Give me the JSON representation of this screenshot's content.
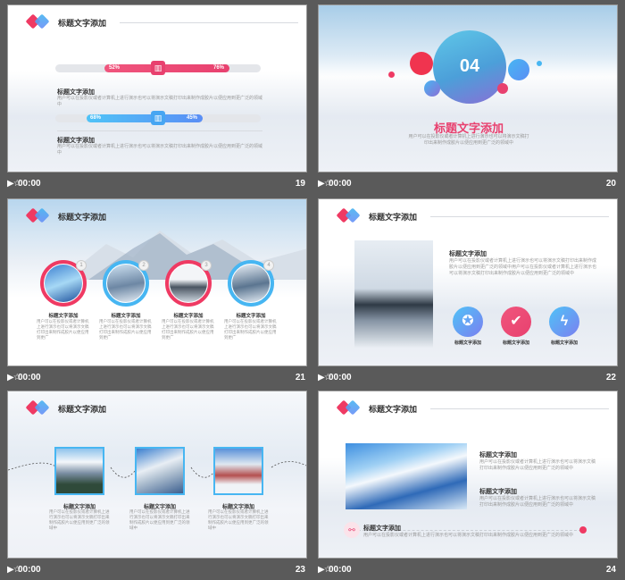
{
  "colors": {
    "red": "#ef3a63",
    "blue": "#44b4f0",
    "pink": "#e8416f"
  },
  "play_glyph": "▶☆",
  "slides": [
    {
      "number": "19",
      "time": "00:00",
      "title": "标题文字添加",
      "bars": [
        {
          "left": "52%",
          "right": "76%",
          "left_val": 0.52,
          "right_val": 0.76
        },
        {
          "left": "68%",
          "right": "45%",
          "left_val": 0.68,
          "right_val": 0.45
        }
      ],
      "block1_title": "标题文字添加",
      "block1_text": "用户可以在投影仪或者计算机上进行演示也可以将演示文稿打印出来制作成胶片以便应用到更广泛的领域中",
      "block2_title": "标题文字添加",
      "block2_text": "用户可以在投影仪或者计算机上进行演示也可以将演示文稿打印出来制作成胶片以便应用到更广泛的领域中"
    },
    {
      "number": "20",
      "time": "00:00",
      "big_number": "04",
      "title": "标题文字添加",
      "text": "用户可以在投影仪或者计算机上进行演示也可以将演示文稿打印出来制作成胶片以便应用到更广泛的领域中"
    },
    {
      "number": "21",
      "time": "00:00",
      "title": "标题文字添加",
      "items": [
        {
          "n": "1",
          "title": "标题文字添加",
          "text": "用户可以在投影仪或者计算机上进行演示也可以将演示文稿打印出来制作成胶片以便应用到更广"
        },
        {
          "n": "2",
          "title": "标题文字添加",
          "text": "用户可以在投影仪或者计算机上进行演示也可以将演示文稿打印出来制作成胶片以便应用到更广"
        },
        {
          "n": "3",
          "title": "标题文字添加",
          "text": "用户可以在投影仪或者计算机上进行演示也可以将演示文稿打印出来制作成胶片以便应用到更广"
        },
        {
          "n": "4",
          "title": "标题文字添加",
          "text": "用户可以在投影仪或者计算机上进行演示也可以将演示文稿打印出来制作成胶片以便应用到更广"
        }
      ]
    },
    {
      "number": "22",
      "time": "00:00",
      "title": "标题文字添加",
      "block_title": "标题文字添加",
      "block_text": "用户可以在投影仪或者计算机上进行演示也可以将演示文稿打印出来制作成胶片以便应用到更广泛的领域中用户可以在投影仪或者计算机上进行演示也可以将演示文稿打印出来制作成胶片以便应用到更广泛的领域中",
      "icons": [
        {
          "name": "badge-icon",
          "label": "标题文字添加",
          "glyph": "✪"
        },
        {
          "name": "check-icon",
          "label": "标题文字添加",
          "glyph": "✔"
        },
        {
          "name": "lightning-icon",
          "label": "标题文字添加",
          "glyph": "ϟ"
        }
      ]
    },
    {
      "number": "23",
      "time": "00:00",
      "title": "标题文字添加",
      "items": [
        {
          "title": "标题文字添加",
          "text": "用户可以在投影仪或者计算机上进行演示也可以将演示文稿打印出来制作成胶片以便应用到更广泛的领域中"
        },
        {
          "title": "标题文字添加",
          "text": "用户可以在投影仪或者计算机上进行演示也可以将演示文稿打印出来制作成胶片以便应用到更广泛的领域中"
        },
        {
          "title": "标题文字添加",
          "text": "用户可以在投影仪或者计算机上进行演示也可以将演示文稿打印出来制作成胶片以便应用到更广泛的领域中"
        }
      ]
    },
    {
      "number": "24",
      "time": "00:00",
      "title": "标题文字添加",
      "block1_title": "标题文字添加",
      "block1_text": "用户可以在投影仪或者计算机上进行演示也可以将演示文稿打印出来制作成胶片以便应用到更广泛的领域中",
      "block2_title": "标题文字添加",
      "block2_text": "用户可以在投影仪或者计算机上进行演示也可以将演示文稿打印出来制作成胶片以便应用到更广泛的领域中",
      "bottom_title": "标题文字添加",
      "bottom_text": "用户可以在投影仪或者计算机上进行演示也可以将演示文稿打印出来制作成胶片以便应用到更广泛的领域中"
    }
  ]
}
